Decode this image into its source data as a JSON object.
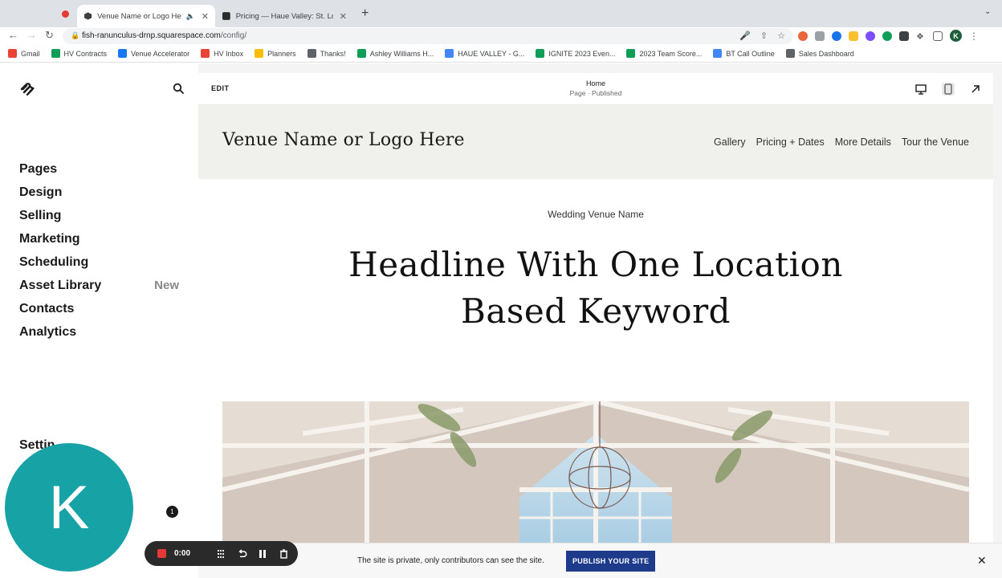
{
  "browser": {
    "tabs": [
      {
        "title": "Venue Name or Logo Here",
        "active": true,
        "audio": true
      },
      {
        "title": "Pricing — Haue Valley: St. Loui",
        "active": false,
        "audio": false
      }
    ],
    "url_host": "fish-ranunculus-drnp.squarespace.com",
    "url_path": "/config/",
    "bookmarks": [
      {
        "label": "Gmail",
        "color": "#ea4335"
      },
      {
        "label": "HV Contracts",
        "color": "#0f9d58"
      },
      {
        "label": "Venue Accelerator",
        "color": "#1877f2"
      },
      {
        "label": "HV Inbox",
        "color": "#ea4335"
      },
      {
        "label": "Planners",
        "color": "#fbbc04"
      },
      {
        "label": "Thanks!",
        "color": "#5f6368"
      },
      {
        "label": "Ashley Williams H...",
        "color": "#0f9d58"
      },
      {
        "label": "HAUE VALLEY - G...",
        "color": "#4285f4"
      },
      {
        "label": "IGNITE 2023 Even...",
        "color": "#0f9d58"
      },
      {
        "label": "2023 Team Score...",
        "color": "#0f9d58"
      },
      {
        "label": "BT Call Outline",
        "color": "#4285f4"
      },
      {
        "label": "Sales Dashboard",
        "color": "#5f6368"
      }
    ],
    "profile_initial": "K"
  },
  "sidebar": {
    "items": [
      {
        "label": "Pages",
        "badge": ""
      },
      {
        "label": "Design",
        "badge": ""
      },
      {
        "label": "Selling",
        "badge": ""
      },
      {
        "label": "Marketing",
        "badge": ""
      },
      {
        "label": "Scheduling",
        "badge": ""
      },
      {
        "label": "Asset Library",
        "badge": "New"
      },
      {
        "label": "Contacts",
        "badge": ""
      },
      {
        "label": "Analytics",
        "badge": ""
      }
    ],
    "settings_label": "Settin",
    "notification_count": "1"
  },
  "editor": {
    "edit_label": "EDIT",
    "page_name": "Home",
    "page_status": "Page · Published"
  },
  "site": {
    "logo_text": "Venue Name or Logo Here",
    "nav": [
      "Gallery",
      "Pricing + Dates",
      "More Details",
      "Tour the Venue"
    ],
    "eyebrow": "Wedding Venue Name",
    "headline_line1": "Headline With One Location",
    "headline_line2": "Based Keyword"
  },
  "private_bar": {
    "message": "The site is private, only contributors can see the site.",
    "publish_label": "PUBLISH YOUR SITE"
  },
  "recorder": {
    "time": "0:00",
    "avatar_initial": "K"
  },
  "colors": {
    "publish": "#1e3a8a",
    "avatar": "#17a2a6",
    "site_header": "#f0f0ec"
  }
}
